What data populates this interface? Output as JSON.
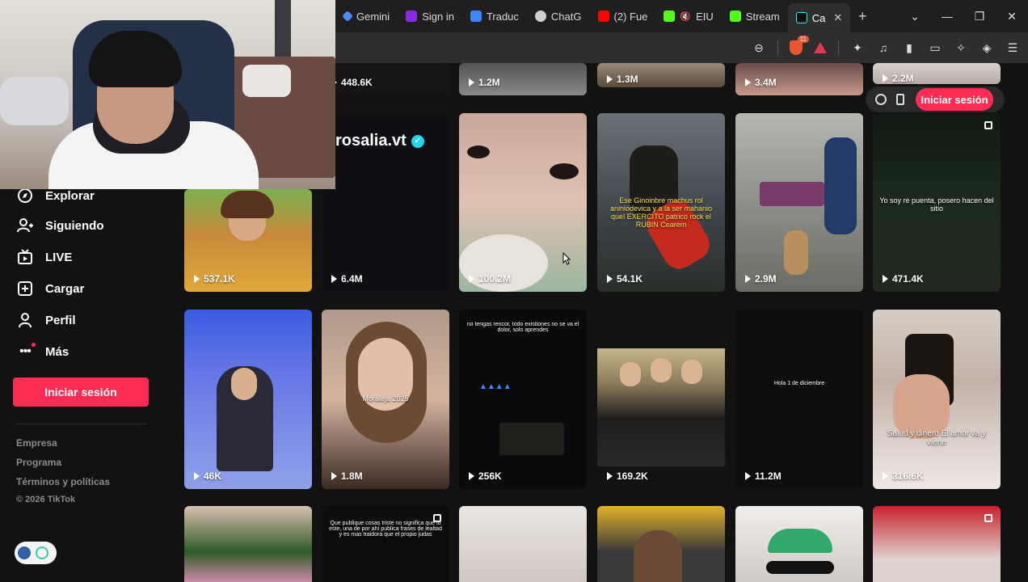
{
  "browser": {
    "tabs": [
      {
        "label": "Gemini",
        "color": "#4b8bf5"
      },
      {
        "label": "Sign in",
        "color": "#8a2be2"
      },
      {
        "label": "Traduc",
        "color": "#4285f4"
      },
      {
        "label": "ChatG",
        "color": "#cfcfcf"
      },
      {
        "label": "(2) Fue",
        "color": "#ff0000"
      },
      {
        "label": "EIU",
        "color": "#53fc18"
      },
      {
        "label": "Stream",
        "color": "#53fc18"
      },
      {
        "label": "Ca",
        "color": "#111111"
      }
    ],
    "brave_badge": "11"
  },
  "sidebar": {
    "items": [
      {
        "label": "Explorar",
        "icon": "compass-icon"
      },
      {
        "label": "Siguiendo",
        "icon": "following-icon"
      },
      {
        "label": "LIVE",
        "icon": "live-tv-icon"
      },
      {
        "label": "Cargar",
        "icon": "upload-icon"
      },
      {
        "label": "Perfil",
        "icon": "profile-icon"
      },
      {
        "label": "Más",
        "icon": "more-icon"
      }
    ],
    "login_label": "Iniciar sesión",
    "footer": [
      "Empresa",
      "Programa",
      "Términos y políticas"
    ],
    "copyright": "© 2026 TikTok"
  },
  "floating": {
    "login_label": "Iniciar sesión"
  },
  "profile_name": "rosalia.vt",
  "rows": {
    "row0": [
      "448.6K",
      "1.2M",
      "1.3M",
      "3.4M",
      "2.2M"
    ],
    "row1": [
      "537.1K",
      "6.4M",
      "100.2M",
      "54.1K",
      "2.9M",
      "471.4K"
    ],
    "row2": [
      "46K",
      "1.8M",
      "256K",
      "169.2K",
      "11.2M",
      "316.6K"
    ]
  },
  "captions": {
    "moraleja": "Moraleja 2025",
    "hola": "Hola 1 de diciembre",
    "salud": "Salud y dinero El amor va y viene",
    "pueblo": "Yo soy re puenta, posero hacen del sitio",
    "ejemplo": "Que publique cosas triste no significa que lo este, una de por ahí publica frases de lealtad y es mas traidora que el propio judas",
    "no_tengas": "no tengas rencor, todo existiones no se va el dolor, solo aprendes"
  }
}
